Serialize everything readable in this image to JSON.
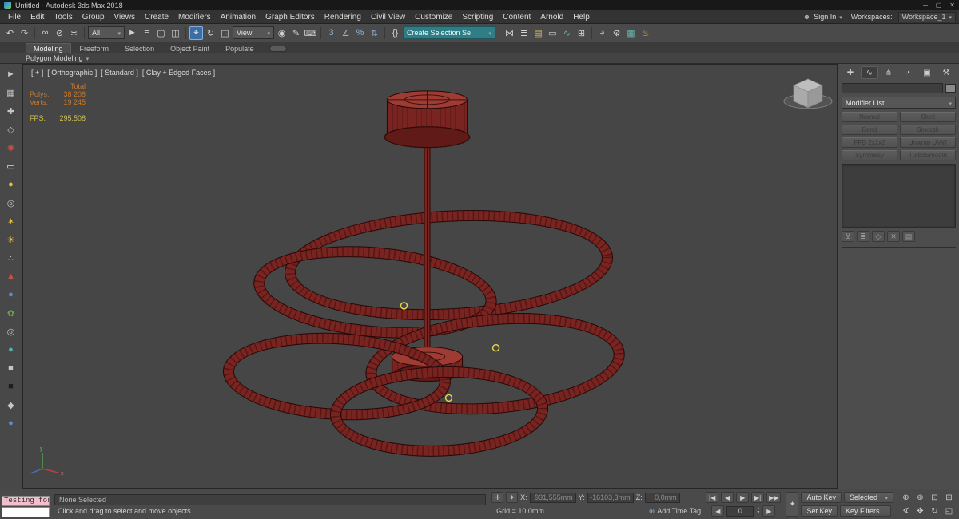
{
  "colors": {
    "viewport-bg": "#464646",
    "wire-fill": "#7a2421",
    "wire-dark": "#250806",
    "wire-tick": "#3c0f0c",
    "wire-light": "#9e3c34",
    "marker": "#e6d24b",
    "stats-orange": "#c8782a",
    "stats-yellow": "#cfc04f",
    "active-blue": "#3a6ea5",
    "selset-teal": "#2f7e86",
    "listener-pink": "#f2bfcc"
  },
  "titlebar": {
    "title": "Untitled - Autodesk 3ds Max 2018",
    "minimize": "─",
    "maximize": "▢",
    "close": "✕"
  },
  "menubar": {
    "items": [
      "File",
      "Edit",
      "Tools",
      "Group",
      "Views",
      "Create",
      "Modifiers",
      "Animation",
      "Graph Editors",
      "Rendering",
      "Civil View",
      "Customize",
      "Scripting",
      "Content",
      "Arnold",
      "Help"
    ],
    "signin": "Sign In",
    "workspaces_label": "Workspaces:",
    "workspace": "Workspace_1"
  },
  "toolbar": {
    "icons_history": [
      {
        "name": "undo-icon",
        "glyph": "↶"
      },
      {
        "name": "redo-icon",
        "glyph": "↷"
      }
    ],
    "icons_link": [
      {
        "name": "select-and-link-icon",
        "glyph": "∞"
      },
      {
        "name": "unlink-selection-icon",
        "glyph": "⊘"
      },
      {
        "name": "bind-to-space-warp-icon",
        "glyph": "≍"
      }
    ],
    "filter_value": "All",
    "icons_select": [
      {
        "name": "select-object-icon",
        "glyph": "►"
      },
      {
        "name": "select-by-name-icon",
        "glyph": "≡"
      },
      {
        "name": "rectangular-selection-region-icon",
        "glyph": "▢"
      },
      {
        "name": "window-crossing-icon",
        "glyph": "◫"
      }
    ],
    "icons_transform": [
      {
        "name": "select-and-move-icon",
        "glyph": "⌖",
        "active": true
      },
      {
        "name": "select-and-rotate-icon",
        "glyph": "↻"
      },
      {
        "name": "select-and-scale-icon",
        "glyph": "◳"
      }
    ],
    "coord_value": "View",
    "icons_pivot": [
      {
        "name": "use-pivot-point-center-icon",
        "glyph": "◉"
      },
      {
        "name": "select-and-manipulate-icon",
        "glyph": "✎"
      },
      {
        "name": "keyboard-shortcut-override-icon",
        "glyph": "⌨"
      }
    ],
    "icons_snap": [
      {
        "name": "snap-toggle-3d-icon",
        "glyph": "3",
        "cls": "c-blue"
      },
      {
        "name": "angle-snap-icon",
        "glyph": "∠",
        "cls": "c-blue"
      },
      {
        "name": "percent-snap-icon",
        "glyph": "%",
        "cls": "c-blue"
      },
      {
        "name": "spinner-snap-icon",
        "glyph": "⇅",
        "cls": "c-blue"
      }
    ],
    "icons_selset": [
      {
        "name": "edit-named-selection-sets-icon",
        "glyph": "{}"
      }
    ],
    "selset_value": "Create Selection Se",
    "icons_tools": [
      {
        "name": "mirror-icon",
        "glyph": "⋈"
      },
      {
        "name": "align-icon",
        "glyph": "≣"
      },
      {
        "name": "layer-manager-icon",
        "glyph": "▤",
        "cls": "c-yellow"
      },
      {
        "name": "ribbon-toggle-icon",
        "glyph": "▭"
      },
      {
        "name": "curve-editor-icon",
        "glyph": "∿",
        "cls": "c-teal"
      },
      {
        "name": "schematic-view-icon",
        "glyph": "⊞"
      }
    ],
    "icons_render": [
      {
        "name": "material-editor-icon",
        "glyph": "◕",
        "cls": "c-blue"
      },
      {
        "name": "render-setup-icon",
        "glyph": "⚙"
      },
      {
        "name": "rendered-frame-window-icon",
        "glyph": "▦",
        "cls": "c-teal"
      },
      {
        "name": "render-production-icon",
        "glyph": "♨",
        "cls": "c-orange"
      }
    ]
  },
  "ribbon": {
    "tabs": [
      {
        "label": "Modeling",
        "active": true
      },
      {
        "label": "Freeform"
      },
      {
        "label": "Selection"
      },
      {
        "label": "Object Paint"
      },
      {
        "label": "Populate"
      }
    ],
    "subtab": "Polygon Modeling"
  },
  "left_toolbar": {
    "icons": [
      {
        "name": "left-tool-select-icon",
        "glyph": "►"
      },
      {
        "name": "left-tool-grid-icon",
        "glyph": "▦"
      },
      {
        "name": "left-tool-add-icon",
        "glyph": "✚"
      },
      {
        "name": "left-tool-shape-icon",
        "glyph": "◇"
      },
      {
        "name": "left-tool-burst-icon",
        "glyph": "✺",
        "cls": "red"
      },
      {
        "name": "left-tool-plane-icon",
        "glyph": "▭",
        "cls": "white"
      },
      {
        "name": "left-tool-sphere-icon",
        "glyph": "●",
        "cls": "yellow"
      },
      {
        "name": "left-tool-torus-icon",
        "glyph": "◎"
      },
      {
        "name": "left-tool-star-icon",
        "glyph": "✶",
        "cls": "yellow"
      },
      {
        "name": "left-tool-light-icon",
        "glyph": "☀",
        "cls": "yellow"
      },
      {
        "name": "left-tool-scatter-icon",
        "glyph": "∴"
      },
      {
        "name": "left-tool-cone-icon",
        "glyph": "▲",
        "cls": "red"
      },
      {
        "name": "left-tool-ball-icon",
        "glyph": "●",
        "cls": "blue"
      },
      {
        "name": "left-tool-foliage-icon",
        "glyph": "✿",
        "cls": "green"
      },
      {
        "name": "left-tool-ring-icon",
        "glyph": "◎"
      },
      {
        "name": "left-tool-teal-sphere-icon",
        "glyph": "●",
        "cls": "teal"
      },
      {
        "name": "left-tool-box-icon",
        "glyph": "■"
      },
      {
        "name": "left-tool-dark-box-icon",
        "glyph": "■",
        "cls": "black"
      },
      {
        "name": "left-tool-diamond-icon",
        "glyph": "◆"
      },
      {
        "name": "left-tool-blue-dot-icon",
        "glyph": "●",
        "cls": "blue"
      }
    ]
  },
  "viewport": {
    "label_segments": [
      {
        "text": "[ + ]",
        "name": "viewport-general-menu"
      },
      {
        "text": "[ Orthographic ]",
        "name": "viewport-pov-menu"
      },
      {
        "text": "[ Standard ]",
        "name": "viewport-render-style-menu"
      },
      {
        "text": "[ Clay + Edged Faces ]",
        "name": "viewport-shading-menu"
      }
    ],
    "stats": {
      "total": "Total",
      "polys_label": "Polys:",
      "polys": "38 208",
      "verts_label": "Verts:",
      "verts": "19 245",
      "fps_label": "FPS:",
      "fps": "295.508"
    }
  },
  "command_panel": {
    "tabs": [
      {
        "name": "create-tab-icon",
        "glyph": "✚"
      },
      {
        "name": "modify-tab-icon",
        "glyph": "∿",
        "active": true
      },
      {
        "name": "hierarchy-tab-icon",
        "glyph": "⋔"
      },
      {
        "name": "motion-tab-icon",
        "glyph": "◔"
      },
      {
        "name": "display-tab-icon",
        "glyph": "▣"
      },
      {
        "name": "utilities-tab-icon",
        "glyph": "⚒"
      }
    ],
    "object_name_value": "",
    "modifier_list_label": "Modifier List",
    "modifier_buttons": [
      "Normal",
      "Shell",
      "Bend",
      "Smooth",
      "FFD 2x2x2",
      "Unwrap UVW",
      "Symmetry",
      "TurboSmooth"
    ],
    "stack_tools": [
      {
        "name": "pin-stack-icon",
        "glyph": "⊻"
      },
      {
        "name": "show-end-result-icon",
        "glyph": "≣"
      },
      {
        "name": "make-unique-icon",
        "glyph": "◇"
      },
      {
        "name": "remove-modifier-icon",
        "glyph": "✕"
      },
      {
        "name": "configure-modifier-sets-icon",
        "glyph": "▤"
      }
    ]
  },
  "statusbar": {
    "listener_text": "Testing for i",
    "selection_status": "None Selected",
    "prompt": "Click and drag to select and move objects",
    "x_label": "X:",
    "x_value": "931,555mm",
    "y_label": "Y:",
    "y_value": "-16103,3mm",
    "z_label": "Z:",
    "z_value": "0,0mm",
    "grid_text": "Grid = 10,0mm",
    "add_time_tag": "Add Time Tag",
    "frame_value": "0",
    "auto_key": "Auto Key",
    "set_key": "Set Key",
    "selected_dropdown": "Selected",
    "key_filters": "Key Filters...",
    "playback": [
      {
        "name": "go-to-start-icon",
        "glyph": "|◀"
      },
      {
        "name": "previous-frame-icon",
        "glyph": "◀"
      },
      {
        "name": "play-icon",
        "glyph": "▶"
      },
      {
        "name": "next-frame-icon",
        "glyph": "▶|"
      },
      {
        "name": "go-to-end-icon",
        "glyph": "▶▶"
      }
    ],
    "nav_icons": [
      {
        "name": "zoom-icon",
        "glyph": "⊕"
      },
      {
        "name": "zoom-all-icon",
        "glyph": "⊛"
      },
      {
        "name": "zoom-extents-icon",
        "glyph": "⊡"
      },
      {
        "name": "zoom-extents-all-icon",
        "glyph": "⊞"
      },
      {
        "name": "field-of-view-icon",
        "glyph": "∢"
      },
      {
        "name": "pan-icon",
        "glyph": "✥"
      },
      {
        "name": "orbit-icon",
        "glyph": "↻"
      },
      {
        "name": "maximize-viewport-toggle-icon",
        "glyph": "◱"
      }
    ]
  }
}
